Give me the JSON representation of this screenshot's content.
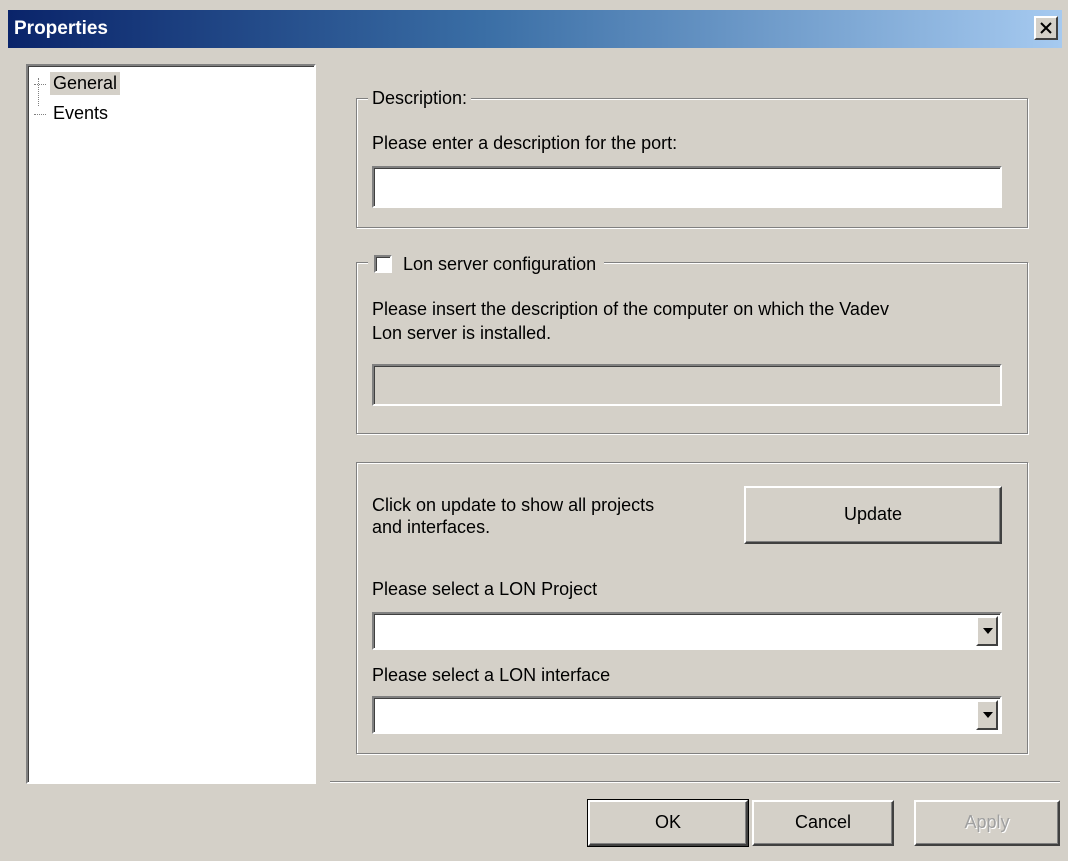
{
  "window": {
    "title": "Properties"
  },
  "tree": {
    "items": [
      {
        "label": "General",
        "selected": true
      },
      {
        "label": "Events",
        "selected": false
      }
    ]
  },
  "description_group": {
    "legend": "Description:",
    "prompt": "Please enter a description for the port:",
    "value": ""
  },
  "lon_server_group": {
    "checkbox_label": "Lon server configuration",
    "checked": false,
    "prompt_line1": "Please insert the description of the computer on which the Vadev",
    "prompt_line2": "Lon server is installed.",
    "value": ""
  },
  "project_group": {
    "update_text_line1": "Click on update to show all projects",
    "update_text_line2": "and interfaces.",
    "update_button": "Update",
    "project_label": "Please select a LON Project",
    "project_value": "",
    "interface_label": "Please select a LON interface",
    "interface_value": ""
  },
  "buttons": {
    "ok": "OK",
    "cancel": "Cancel",
    "apply": "Apply"
  },
  "icons": {
    "close": "close-icon",
    "dropdown": "chevron-down-icon"
  },
  "colors": {
    "title_gradient_start": "#0a246a",
    "title_gradient_end": "#a6caf0",
    "dialog_face": "#d4d0c8"
  }
}
